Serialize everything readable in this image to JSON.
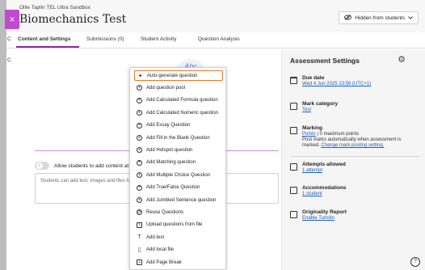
{
  "header": {
    "course_title": "Ollie Taplin TEL Ultra Sandbox",
    "page_title": "Biomechanics Test",
    "visibility": "Hidden from students",
    "close_glyph": "×"
  },
  "tabs": [
    {
      "label": "Content and Settings"
    },
    {
      "label": "Submissions (0)"
    },
    {
      "label": "Student Activity"
    },
    {
      "label": "Question Analysis"
    }
  ],
  "edge": {
    "tab_fragment": "C",
    "content_fragment": "C"
  },
  "content": {
    "abc_text": "Abc",
    "allow_label": "Allow students to add content at end",
    "students_placeholder": "Students can add text, images and files here"
  },
  "menu": {
    "items": [
      {
        "label": "Auto-generate question",
        "icon": "magic-wand-icon",
        "glyph": "✦",
        "style": "plain"
      },
      {
        "label": "Add question pool",
        "icon": "plus-circle-icon",
        "glyph": "+",
        "style": "circle"
      },
      {
        "label": "Add Calculated Formula question",
        "icon": "plus-circle-icon",
        "glyph": "+",
        "style": "circle"
      },
      {
        "label": "Add Calculated Numeric question",
        "icon": "plus-circle-icon",
        "glyph": "+",
        "style": "circle"
      },
      {
        "label": "Add Essay Question",
        "icon": "plus-circle-icon",
        "glyph": "+",
        "style": "circle"
      },
      {
        "label": "Add Fill in the Blank Question",
        "icon": "plus-circle-icon",
        "glyph": "+",
        "style": "circle"
      },
      {
        "label": "Add Hotspot question",
        "icon": "plus-circle-icon",
        "glyph": "+",
        "style": "circle"
      },
      {
        "label": "Add Matching question",
        "icon": "plus-circle-icon",
        "glyph": "+",
        "style": "circle"
      },
      {
        "label": "Add Multiple Choice Question",
        "icon": "plus-circle-icon",
        "glyph": "+",
        "style": "circle"
      },
      {
        "label": "Add True/False Question",
        "icon": "plus-circle-icon",
        "glyph": "+",
        "style": "circle"
      },
      {
        "label": "Add Jumbled Sentence question",
        "icon": "plus-circle-icon",
        "glyph": "+",
        "style": "circle"
      },
      {
        "label": "Reuse Questions",
        "icon": "reuse-icon",
        "glyph": "⟳",
        "style": "circle"
      },
      {
        "label": "Upload questions from file",
        "icon": "upload-icon",
        "glyph": "⇪",
        "style": "box"
      },
      {
        "label": "Add text",
        "icon": "text-icon",
        "glyph": "T",
        "style": "plain"
      },
      {
        "label": "Add local file",
        "icon": "file-icon",
        "glyph": "▯",
        "style": "plain"
      },
      {
        "label": "Add Page Break",
        "icon": "page-break-icon",
        "glyph": "+",
        "style": "box"
      }
    ]
  },
  "sidebar": {
    "title": "Assessment Settings",
    "due_date": {
      "label": "Due date",
      "value": "Wed 4 Jun 2025 23:59 (UTC+1)"
    },
    "mark_category": {
      "label": "Mark category",
      "value": "Test"
    },
    "marking": {
      "label": "Marking",
      "points_link": "Points",
      "points_text": " | 0 maximum points",
      "line2": "Post marks automatically when assessment is",
      "line3_prefix": "marked. ",
      "change_link": "Change mark posting setting."
    },
    "attempts": {
      "label": "Attempts allowed",
      "value": "1 attempt"
    },
    "accommodations": {
      "label": "Accommodations",
      "value": "1 student"
    },
    "originality": {
      "label": "Originality Report",
      "value": "Enable Turnitin"
    }
  },
  "help": {
    "glyph": "?"
  },
  "colors": {
    "accent": "#8a2c9a",
    "close_button": "#c04ad0",
    "link": "#1f5fb5",
    "menu_highlight": "#e07b22"
  }
}
